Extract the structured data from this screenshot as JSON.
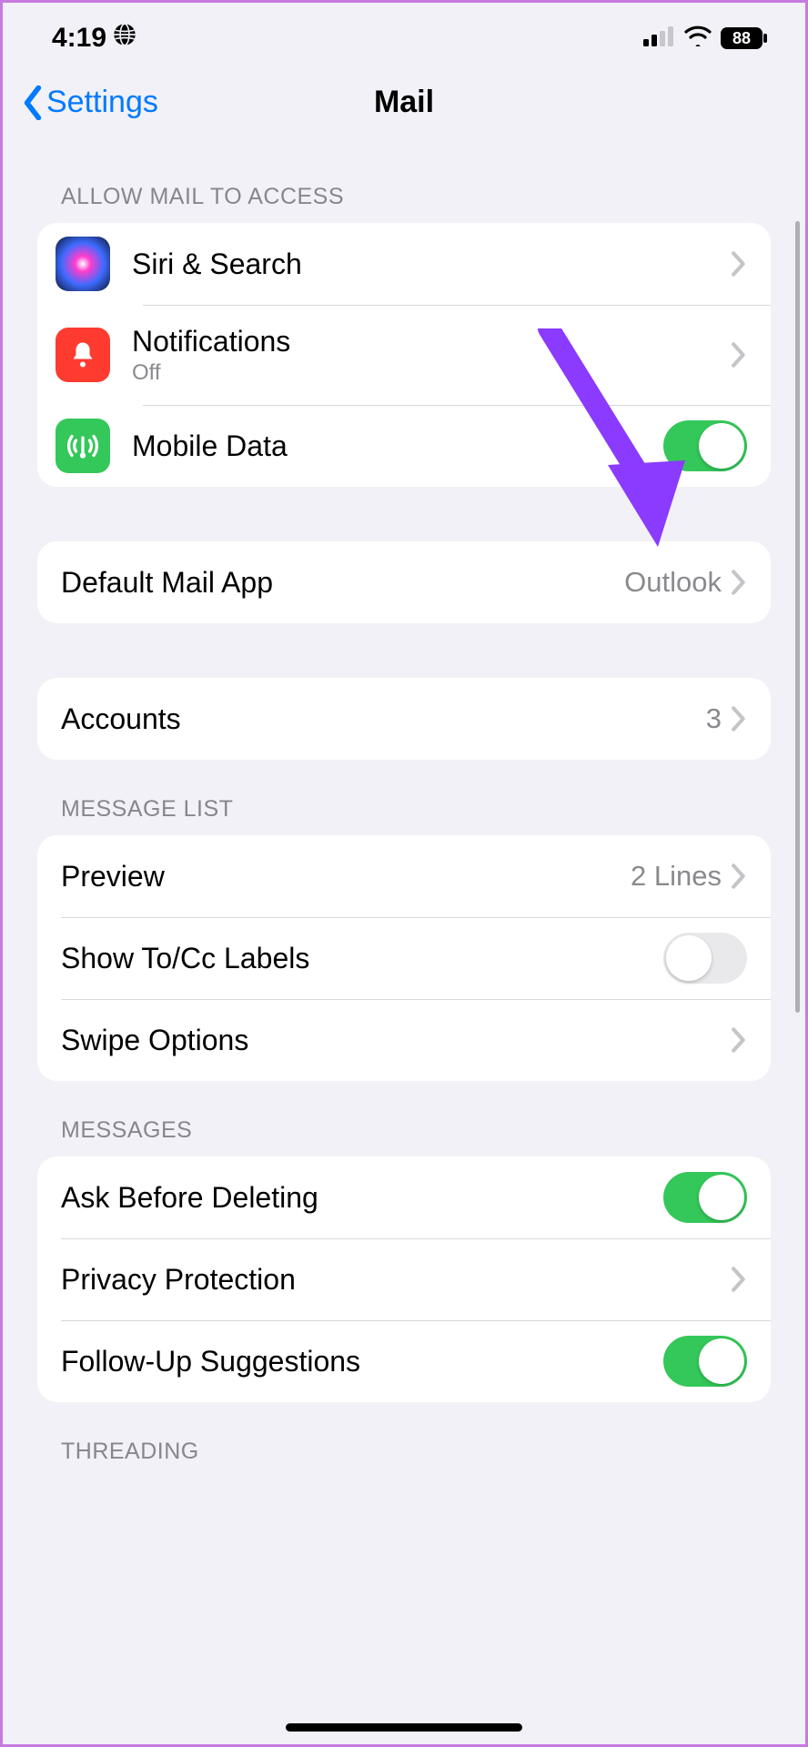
{
  "status": {
    "time": "4:19",
    "battery": "88"
  },
  "nav": {
    "back": "Settings",
    "title": "Mail"
  },
  "sections": {
    "allow": {
      "header": "ALLOW MAIL TO ACCESS",
      "siri": "Siri & Search",
      "notifications": "Notifications",
      "notifications_sub": "Off",
      "mobile_data": "Mobile Data",
      "mobile_data_on": true
    },
    "default_app": {
      "label": "Default Mail App",
      "value": "Outlook"
    },
    "accounts": {
      "label": "Accounts",
      "value": "3"
    },
    "message_list": {
      "header": "MESSAGE LIST",
      "preview": "Preview",
      "preview_value": "2 Lines",
      "show_to_cc": "Show To/Cc Labels",
      "show_to_cc_on": false,
      "swipe": "Swipe Options"
    },
    "messages": {
      "header": "MESSAGES",
      "ask_delete": "Ask Before Deleting",
      "ask_delete_on": true,
      "privacy": "Privacy Protection",
      "follow_up": "Follow-Up Suggestions",
      "follow_up_on": true
    },
    "threading": {
      "header": "THREADING"
    }
  }
}
